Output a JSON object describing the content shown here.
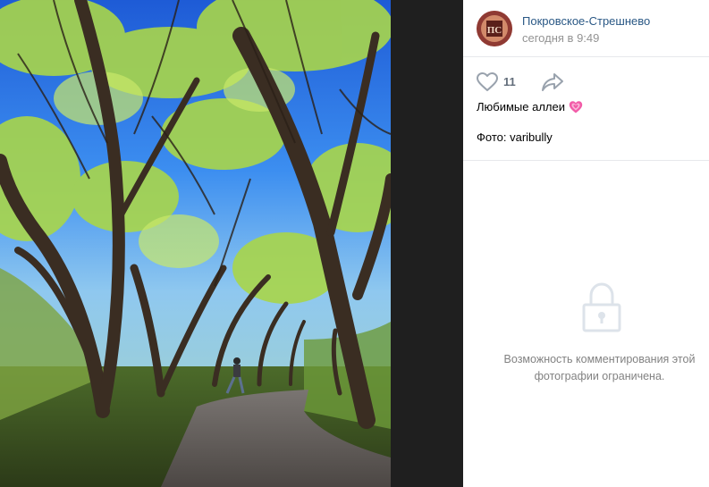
{
  "post": {
    "author_name": "Покровское-Стрешнево",
    "timestamp": "сегодня в 9:49",
    "avatar_text": "ПС",
    "likes_count": "11",
    "caption": "Любимые аллеи",
    "caption_emoji": "pink-heart-emoji",
    "photo_credit": "Фото: varibully"
  },
  "comments": {
    "restricted_message": "Возможность комментирования этой фотографии ограничена."
  },
  "icons": {
    "like": "heart-outline-icon",
    "share": "share-arrow-icon",
    "lock": "lock-icon"
  },
  "colors": {
    "link": "#2a5885",
    "secondary_text": "#939393",
    "icon": "#99a2ad",
    "viewer_background": "#1f1f1f",
    "avatar": "#b8524a"
  }
}
